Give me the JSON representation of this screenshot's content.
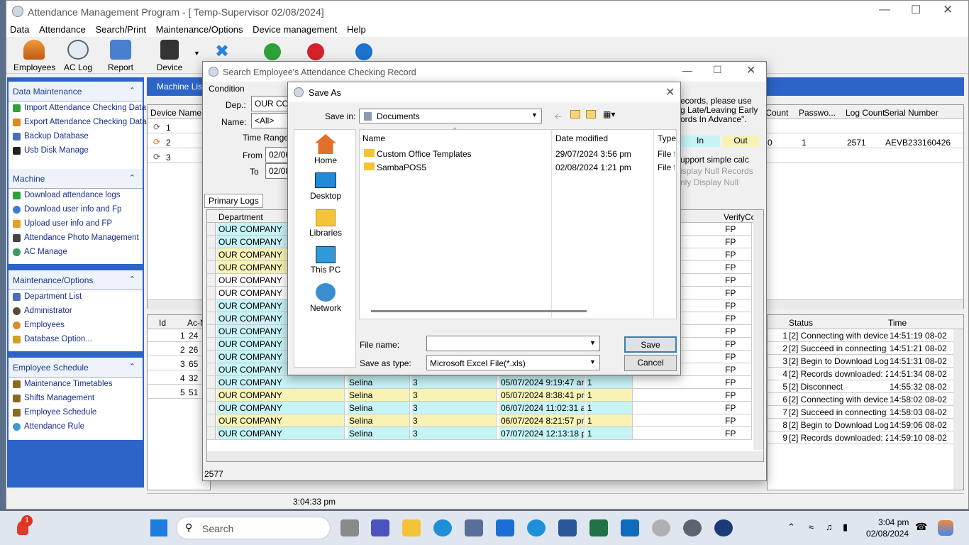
{
  "app": {
    "title": "Attendance Management Program - [ Temp-Supervisor 02/08/2024]",
    "menu": [
      "Data",
      "Attendance",
      "Search/Print",
      "Maintenance/Options",
      "Device management",
      "Help"
    ],
    "toolbar": {
      "employees": "Employees",
      "ac_log": "AC Log",
      "report": "Report",
      "device": "Device"
    },
    "machine_list_tab": "Machine List",
    "device_cols": [
      "Device Name",
      "c Count",
      "Passwo...",
      "Log Count",
      "Serial Number"
    ],
    "device_rows": [
      {
        "name": "1",
        "count": "",
        "pass": "",
        "log": "",
        "serial": ""
      },
      {
        "name": "2",
        "count": "0",
        "pass": "1",
        "log": "2571",
        "serial": "AEVB233160426"
      },
      {
        "name": "3",
        "count": "",
        "pass": "",
        "log": "",
        "serial": ""
      }
    ],
    "log_cols": [
      "Id",
      "Ac-N"
    ],
    "log_rows": [
      [
        "1",
        "24"
      ],
      [
        "2",
        "26"
      ],
      [
        "3",
        "65"
      ],
      [
        "4",
        "32"
      ],
      [
        "5",
        "51"
      ]
    ],
    "status_cols": [
      "Status",
      "Time"
    ],
    "status_rows": [
      {
        "id": "1",
        "status": "[2] Connecting with device,pl",
        "time": "14:51:19 08-02"
      },
      {
        "id": "2",
        "status": "[2] Succeed in connecting wi",
        "time": "14:51:21 08-02"
      },
      {
        "id": "3",
        "status": "[2] Begin to Download Log",
        "time": "14:51:31 08-02"
      },
      {
        "id": "4",
        "status": "[2]  Records downloaded: 25",
        "time": "14:51:34 08-02"
      },
      {
        "id": "5",
        "status": "[2] Disconnect",
        "time": "14:55:32 08-02"
      },
      {
        "id": "6",
        "status": "[2] Connecting with device,pl",
        "time": "14:58:02 08-02"
      },
      {
        "id": "7",
        "status": "[2] Succeed in connecting wi",
        "time": "14:58:03 08-02"
      },
      {
        "id": "8",
        "status": "[2] Begin to Download Log",
        "time": "14:59:06 08-02"
      },
      {
        "id": "9",
        "status": "[2]  Records downloaded: 25",
        "time": "14:59:10 08-02"
      }
    ],
    "status_time": "3:04:33 pm"
  },
  "sidebar": {
    "data_maintenance": {
      "title": "Data Maintenance",
      "items": [
        "Import Attendance Checking Data",
        "Export Attendance Checking Data",
        "Backup Database",
        "Usb Disk Manage"
      ]
    },
    "machine": {
      "title": "Machine",
      "items": [
        "Download attendance logs",
        "Download user info and Fp",
        "Upload user info and FP",
        "Attendance Photo Management",
        "AC Manage"
      ]
    },
    "maintenance": {
      "title": "Maintenance/Options",
      "items": [
        "Department List",
        "Administrator",
        "Employees",
        "Database Option..."
      ]
    },
    "schedule": {
      "title": "Employee Schedule",
      "items": [
        "Maintenance Timetables",
        "Shifts Management",
        "Employee Schedule",
        "Attendance Rule"
      ]
    }
  },
  "search_dialog": {
    "title": "Search Employee's Attendance Checking Record",
    "condition": "Condition",
    "dep_label": "Dep.:",
    "dep_value": "OUR COM",
    "name_label": "Name:",
    "name_value": "<All>",
    "time_range": "Time Range",
    "from_label": "From",
    "from_value": "02/06",
    "to_label": "To",
    "to_value": "02/08",
    "note1": "ecords, please use",
    "note2": "g Late/Leaving Early",
    "note3": "ords In Advance\".",
    "in_label": "In",
    "out_label": "Out",
    "opt1": "upport simple calc",
    "opt2": "isplay Null Records",
    "opt3": "nly Display Null",
    "tab": "Primary Logs",
    "col_department": "Department",
    "col_verify": "VerifyCo",
    "record_count": "2577",
    "rows": [
      {
        "dept": "OUR COMPANY",
        "name": "",
        "no": "",
        "time": "",
        "c": "",
        "verify": "FP",
        "color": "#c6f3f6"
      },
      {
        "dept": "OUR COMPANY",
        "name": "",
        "no": "",
        "time": "",
        "c": "",
        "verify": "FP",
        "color": "#c6f3f6"
      },
      {
        "dept": "OUR COMPANY",
        "name": "",
        "no": "",
        "time": "",
        "c": "",
        "verify": "FP",
        "color": "#f7f3b6"
      },
      {
        "dept": "OUR COMPANY",
        "name": "",
        "no": "",
        "time": "",
        "c": "",
        "verify": "FP",
        "color": "#f7f3b6"
      },
      {
        "dept": "OUR COMPANY",
        "name": "",
        "no": "",
        "time": "",
        "c": "",
        "verify": "FP",
        "color": "#ffffff"
      },
      {
        "dept": "OUR COMPANY",
        "name": "",
        "no": "",
        "time": "",
        "c": "",
        "verify": "FP",
        "color": "#ffffff"
      },
      {
        "dept": "OUR COMPANY",
        "name": "",
        "no": "",
        "time": "",
        "c": "",
        "verify": "FP",
        "color": "#c6f3f6"
      },
      {
        "dept": "OUR COMPANY",
        "name": "",
        "no": "",
        "time": "",
        "c": "",
        "verify": "FP",
        "color": "#c6f3f6"
      },
      {
        "dept": "OUR COMPANY",
        "name": "",
        "no": "",
        "time": "",
        "c": "",
        "verify": "FP",
        "color": "#c6f3f6"
      },
      {
        "dept": "OUR COMPANY",
        "name": "",
        "no": "",
        "time": "",
        "c": "",
        "verify": "FP",
        "color": "#c6f3f6"
      },
      {
        "dept": "OUR COMPANY",
        "name": "",
        "no": "",
        "time": "",
        "c": "",
        "verify": "FP",
        "color": "#c6f3f6"
      },
      {
        "dept": "OUR COMPANY",
        "name": "",
        "no": "",
        "time": "",
        "c": "",
        "verify": "FP",
        "color": "#c6f3f6"
      },
      {
        "dept": "OUR COMPANY",
        "name": "Selina",
        "no": "3",
        "time": "05/07/2024 9:19:47 am",
        "c": "1",
        "verify": "FP",
        "color": "#c6f3f6"
      },
      {
        "dept": "OUR COMPANY",
        "name": "Selina",
        "no": "3",
        "time": "05/07/2024 8:38:41 pm",
        "c": "1",
        "verify": "FP",
        "color": "#f7f3b6"
      },
      {
        "dept": "OUR COMPANY",
        "name": "Selina",
        "no": "3",
        "time": "06/07/2024 11:02:31 an",
        "c": "1",
        "verify": "FP",
        "color": "#c6f3f6"
      },
      {
        "dept": "OUR COMPANY",
        "name": "Selina",
        "no": "3",
        "time": "06/07/2024 8:21:57 pm",
        "c": "1",
        "verify": "FP",
        "color": "#f7f3b6"
      },
      {
        "dept": "OUR COMPANY",
        "name": "Selina",
        "no": "3",
        "time": "07/07/2024 12:13:18 pı",
        "c": "1",
        "verify": "FP",
        "color": "#c6f3f6"
      }
    ]
  },
  "save_dialog": {
    "title": "Save As",
    "save_in_label": "Save in:",
    "save_in_value": "Documents",
    "places": [
      "Home",
      "Desktop",
      "Libraries",
      "This PC",
      "Network"
    ],
    "col_name": "Name",
    "col_date": "Date modified",
    "col_type": "Type",
    "files": [
      {
        "name": "Custom Office Templates",
        "date": "29/07/2024 3:56 pm",
        "type": "File fo"
      },
      {
        "name": "SambaPOS5",
        "date": "02/08/2024 1:21 pm",
        "type": "File fo"
      }
    ],
    "file_name_label": "File name:",
    "file_name_value": "",
    "type_label": "Save as type:",
    "type_value": "Microsoft Excel File(*.xls)",
    "save_button": "Save",
    "cancel_button": "Cancel"
  },
  "taskbar": {
    "search": "Search",
    "time": "3:04 pm",
    "date": "02/08/2024",
    "badge": "1"
  }
}
